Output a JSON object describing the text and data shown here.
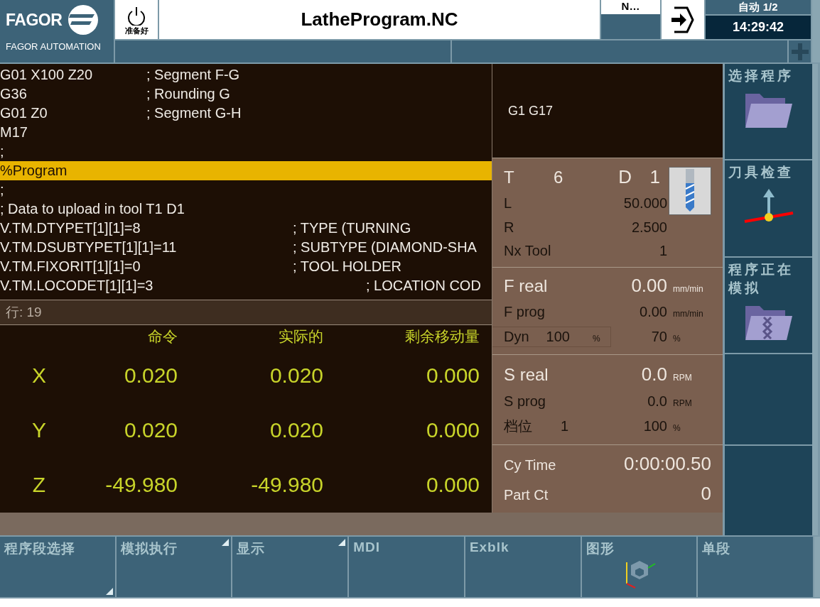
{
  "header": {
    "logo": "FAGOR",
    "company": "FAGOR AUTOMATION",
    "power_label": "准备好",
    "title": "LatheProgram.NC",
    "channel": "N…",
    "mode": "自动 1/2",
    "clock": "14:29:42"
  },
  "program": {
    "lines": [
      {
        "text": "G01 X100 Z20\t; Segment F-G",
        "selected": false
      },
      {
        "text": "G36\t\t; Rounding G",
        "selected": false
      },
      {
        "text": "G01 Z0\t\t; Segment G-H",
        "selected": false
      },
      {
        "text": "M17",
        "selected": false
      },
      {
        "text": ";",
        "selected": false
      },
      {
        "text": "%Program",
        "selected": true
      },
      {
        "text": ";",
        "selected": false
      },
      {
        "text": "; Data to upload in tool T1 D1",
        "selected": false
      },
      {
        "text": "V.TM.DTYPET[1][1]=8\t\t\t; TYPE (TURNING",
        "selected": false
      },
      {
        "text": "V.TM.DSUBTYPET[1][1]=11\t\t; SUBTYPE (DIAMOND-SHA",
        "selected": false
      },
      {
        "text": "V.TM.FIXORIT[1][1]=0\t\t\t; TOOL HOLDER",
        "selected": false
      },
      {
        "text": "V.TM.LOCODET[1][1]=3\t\t\t; LOCATION COD",
        "selected": false
      }
    ],
    "line_info": "行: 19"
  },
  "axes": {
    "columns": [
      "命令",
      "实际的",
      "剩余移动量"
    ],
    "rows": [
      {
        "axis": "X",
        "values": [
          "0.020",
          "0.020",
          "0.000"
        ]
      },
      {
        "axis": "Y",
        "values": [
          "0.020",
          "0.020",
          "0.000"
        ]
      },
      {
        "axis": "Z",
        "values": [
          "-49.980",
          "-49.980",
          "0.000"
        ]
      }
    ]
  },
  "info": {
    "gcodes": "G1 G17",
    "tool": {
      "t_label": "T",
      "t": "6",
      "d_label": "D",
      "d": "1"
    },
    "sections": [
      {
        "rows": [
          {
            "kind": "plain",
            "label": "L",
            "value": "50.000"
          },
          {
            "kind": "plain",
            "label": "R",
            "value": "2.500"
          },
          {
            "kind": "plain",
            "label": "Nx Tool",
            "value": "1"
          }
        ]
      },
      {
        "rows": [
          {
            "kind": "headline",
            "label": "F real",
            "value": "0.00",
            "unit": "mm/min"
          },
          {
            "kind": "plain",
            "label": "F prog",
            "value": "0.00",
            "unit": "mm/min"
          },
          {
            "kind": "override",
            "label": "Dyn",
            "sub_value": "100",
            "sub_unit": "%",
            "value": "70",
            "unit": "%"
          }
        ]
      },
      {
        "rows": [
          {
            "kind": "headline",
            "label": "S real",
            "value": "0.0",
            "unit": "RPM"
          },
          {
            "kind": "plain",
            "label": "S prog",
            "value": "0.0",
            "unit": "RPM"
          },
          {
            "kind": "gear",
            "label": "档位",
            "sub_value": "1",
            "value": "100",
            "unit": "%"
          }
        ]
      },
      {
        "rows": [
          {
            "kind": "readout",
            "label": "Cy Time",
            "value": "0:00:00.50"
          },
          {
            "kind": "readout",
            "label": "Part Ct",
            "value": "0"
          }
        ]
      }
    ]
  },
  "side_keys": [
    {
      "label": "选择程序",
      "kind": "folder"
    },
    {
      "label": "刀具检查",
      "kind": "probe"
    },
    {
      "label": "程序正在模拟",
      "kind": "simulation"
    }
  ],
  "soft_keys": [
    {
      "label": "程序段选择",
      "kind": "submenu"
    },
    {
      "label": "模拟执行",
      "kind": "menu"
    },
    {
      "label": "显示",
      "kind": "menu"
    },
    {
      "label": "MDI",
      "kind": "plain"
    },
    {
      "label": "Exblk",
      "kind": "plain"
    },
    {
      "label": "图形",
      "kind": "graphic"
    },
    {
      "label": "单段",
      "kind": "plain"
    }
  ]
}
